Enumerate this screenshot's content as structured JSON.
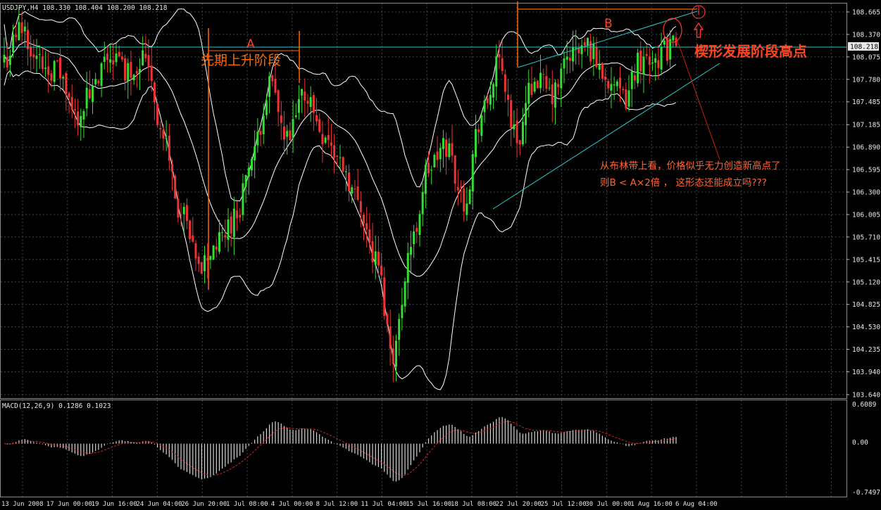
{
  "header": {
    "symbol_line": "USDJPY,H4  108.330 108.404 108.200 108.218"
  },
  "price_axis": {
    "ticks": [
      "108.665",
      "108.370",
      "108.075",
      "107.780",
      "107.485",
      "107.185",
      "106.890",
      "106.595",
      "106.300",
      "106.005",
      "105.710",
      "105.415",
      "105.120",
      "104.825",
      "104.530",
      "104.235",
      "103.940",
      "103.640"
    ],
    "current_price": "108.218"
  },
  "macd": {
    "header": "MACD(12,26,9) 0.1286 0.1023",
    "axis_ticks": [
      "0.6089",
      "0.00",
      "-0.7497"
    ],
    "max": 0.6089,
    "min": -0.7497
  },
  "time_axis": {
    "labels": [
      "13 Jun 2008",
      "17 Jun 00:00",
      "19 Jun 16:00",
      "24 Jun 04:00",
      "26 Jun 20:00",
      "1 Jul 08:00",
      "4 Jul 00:00",
      "8 Jul 12:00",
      "11 Jul 04:00",
      "15 Jul 16:00",
      "18 Jul 08:00",
      "22 Jul 20:00",
      "25 Jul 12:00",
      "30 Jul 00:00",
      "1 Aug 16:00",
      "6 Aug 04:00"
    ]
  },
  "annotations": {
    "label_a": "A",
    "label_b": "B",
    "phase_label": "先期上升阶段",
    "wedge_high_label": "楔形发展阶段高点",
    "comment_line1": "从布林带上看，价格似乎无力创造新高点了",
    "comment_line2": "则B < A×2倍 ， 这形态还能成立吗???"
  },
  "colors": {
    "background": "#000000",
    "grid": "#3b4a52",
    "bull_candle": "#33dd33",
    "bear_candle": "#ee3333",
    "bollinger": "#ffffff",
    "macd_signal": "#dd2222",
    "annotation": "#ff6600",
    "wedge_line": "#22cccc",
    "comment": "#ff6633"
  },
  "chart_data": {
    "type": "candlestick",
    "symbol": "USDJPY",
    "timeframe": "H4",
    "ylim": [
      103.64,
      108.665
    ],
    "last": {
      "open": 108.33,
      "high": 108.404,
      "low": 108.2,
      "close": 108.218
    },
    "close_anchors": [
      {
        "date": "13 Jun 2008",
        "value": 108.05
      },
      {
        "date": "16 Jun 2008",
        "value": 108.45
      },
      {
        "date": "17 Jun 2008",
        "value": 108.0
      },
      {
        "date": "18 Jun 2008",
        "value": 107.9
      },
      {
        "date": "19 Jun 2008",
        "value": 107.3
      },
      {
        "date": "20 Jun 2008",
        "value": 107.6
      },
      {
        "date": "23 Jun 2008",
        "value": 108.1
      },
      {
        "date": "24 Jun 2008",
        "value": 107.9
      },
      {
        "date": "25 Jun 2008",
        "value": 108.1
      },
      {
        "date": "26 Jun 2008",
        "value": 107.0
      },
      {
        "date": "27 Jun 2008",
        "value": 106.0
      },
      {
        "date": "30 Jun 2008",
        "value": 105.3
      },
      {
        "date": "1 Jul 2008",
        "value": 105.6
      },
      {
        "date": "2 Jul 2008",
        "value": 105.95
      },
      {
        "date": "3 Jul 2008",
        "value": 106.7
      },
      {
        "date": "4 Jul 2008",
        "value": 107.7
      },
      {
        "date": "7 Jul 2008",
        "value": 106.95
      },
      {
        "date": "8 Jul 2008",
        "value": 107.6
      },
      {
        "date": "9 Jul 2008",
        "value": 107.1
      },
      {
        "date": "10 Jul 2008",
        "value": 106.7
      },
      {
        "date": "11 Jul 2008",
        "value": 106.2
      },
      {
        "date": "14 Jul 2008",
        "value": 105.4
      },
      {
        "date": "15 Jul 2008",
        "value": 104.2
      },
      {
        "date": "16 Jul 2008",
        "value": 105.6
      },
      {
        "date": "17 Jul 2008",
        "value": 106.6
      },
      {
        "date": "18 Jul 2008",
        "value": 106.9
      },
      {
        "date": "21 Jul 2008",
        "value": 106.2
      },
      {
        "date": "22 Jul 2008",
        "value": 107.3
      },
      {
        "date": "23 Jul 2008",
        "value": 107.95
      },
      {
        "date": "24 Jul 2008",
        "value": 107.0
      },
      {
        "date": "25 Jul 2008",
        "value": 107.8
      },
      {
        "date": "28 Jul 2008",
        "value": 107.55
      },
      {
        "date": "29 Jul 2008",
        "value": 108.1
      },
      {
        "date": "30 Jul 2008",
        "value": 108.2
      },
      {
        "date": "31 Jul 2008",
        "value": 107.85
      },
      {
        "date": "1 Aug 2008",
        "value": 107.5
      },
      {
        "date": "4 Aug 2008",
        "value": 108.05
      },
      {
        "date": "5 Aug 2008",
        "value": 108.1
      },
      {
        "date": "6 Aug 2008",
        "value": 108.218
      }
    ],
    "indicators": [
      "Bollinger Bands",
      "MACD(12,26,9)"
    ]
  }
}
